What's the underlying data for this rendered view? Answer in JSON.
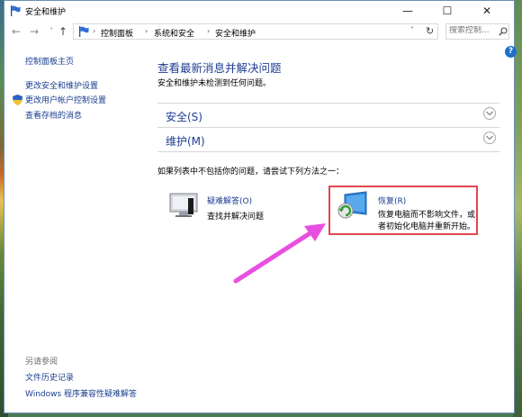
{
  "window": {
    "title": "安全和维护",
    "minimize_glyph": "—",
    "maximize_glyph": "☐",
    "close_glyph": "✕"
  },
  "nav": {
    "back_glyph": "←",
    "forward_glyph": "→",
    "recent_glyph": "˅",
    "up_glyph": "↑",
    "breadcrumbs": [
      "控制面板",
      "系统和安全",
      "安全和维护"
    ],
    "separator": "›",
    "dropdown_glyph": "˅",
    "refresh_glyph": "↻",
    "search_placeholder": "搜索控制..."
  },
  "sidebar": {
    "items": [
      {
        "label": "控制面板主页"
      },
      {
        "label": "更改安全和维护设置"
      },
      {
        "label": "更改用户帐户控制设置"
      },
      {
        "label": "查看存档的消息"
      }
    ],
    "see_also_heading": "另请参阅",
    "see_also": [
      {
        "label": "文件历史记录"
      },
      {
        "label": "Windows 程序兼容性疑难解答"
      }
    ]
  },
  "help": {
    "label": "?"
  },
  "main": {
    "title": "查看最新消息并解决问题",
    "subtitle": "安全和维护未检测到任何问题。",
    "sections": [
      {
        "label": "安全(S)"
      },
      {
        "label": "维护(M)"
      }
    ],
    "try_text": "如果列表中不包括你的问题，请尝试下列方法之一：",
    "troubleshooting": {
      "title": "疑难解答(O)",
      "description": "查找并解决问题"
    },
    "recovery": {
      "title": "恢复(R)",
      "description_line1": "恢复电脑而不影响文件，或",
      "description_line2": "者初始化电脑并重新开始。"
    }
  },
  "colors": {
    "link": "#1a3d8f",
    "heading": "#1e3d92",
    "highlight_box": "#e2464f",
    "annotation_arrow": "#e84fe0"
  }
}
